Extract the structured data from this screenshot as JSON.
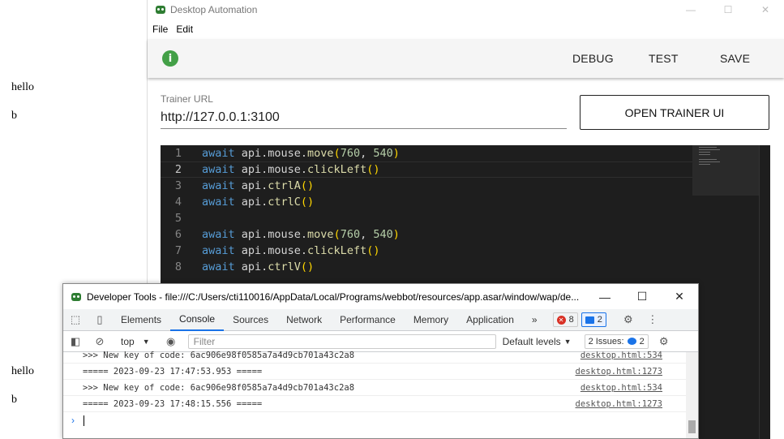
{
  "background": {
    "text_top": "hello",
    "text_top2": "b",
    "text_bottom": "hello",
    "text_bottom2": "b"
  },
  "app": {
    "title": "Desktop Automation",
    "menu": [
      "File",
      "Edit"
    ],
    "toolbar": {
      "debug": "DEBUG",
      "test": "TEST",
      "save": "SAVE",
      "info_icon": "info-icon"
    },
    "trainer_url_label": "Trainer URL",
    "trainer_url_value": "http://127.0.0.1:3100",
    "open_trainer_label": "OPEN TRAINER UI",
    "editor": {
      "lines": [
        {
          "num": "1",
          "parts": [
            [
              "kw",
              "await"
            ],
            [
              "t",
              " api.mouse."
            ],
            [
              "fn",
              "move"
            ],
            [
              "par",
              "("
            ],
            [
              "num",
              "760"
            ],
            [
              "t",
              ", "
            ],
            [
              "num",
              "540"
            ],
            [
              "par",
              ")"
            ]
          ]
        },
        {
          "num": "2",
          "parts": [
            [
              "kw",
              "await"
            ],
            [
              "t",
              " api.mouse."
            ],
            [
              "fn",
              "clickLeft"
            ],
            [
              "par",
              "()"
            ]
          ]
        },
        {
          "num": "3",
          "parts": [
            [
              "kw",
              "await"
            ],
            [
              "t",
              " api."
            ],
            [
              "fn",
              "ctrlA"
            ],
            [
              "par",
              "()"
            ]
          ]
        },
        {
          "num": "4",
          "parts": [
            [
              "kw",
              "await"
            ],
            [
              "t",
              " api."
            ],
            [
              "fn",
              "ctrlC"
            ],
            [
              "par",
              "()"
            ]
          ]
        },
        {
          "num": "5",
          "parts": []
        },
        {
          "num": "6",
          "parts": [
            [
              "kw",
              "await"
            ],
            [
              "t",
              " api.mouse."
            ],
            [
              "fn",
              "move"
            ],
            [
              "par",
              "("
            ],
            [
              "num",
              "760"
            ],
            [
              "t",
              ", "
            ],
            [
              "num",
              "540"
            ],
            [
              "par",
              ")"
            ]
          ]
        },
        {
          "num": "7",
          "parts": [
            [
              "kw",
              "await"
            ],
            [
              "t",
              " api.mouse."
            ],
            [
              "fn",
              "clickLeft"
            ],
            [
              "par",
              "()"
            ]
          ]
        },
        {
          "num": "8",
          "parts": [
            [
              "kw",
              "await"
            ],
            [
              "t",
              " api."
            ],
            [
              "fn",
              "ctrlV"
            ],
            [
              "par",
              "()"
            ]
          ]
        }
      ],
      "active_line": 2
    }
  },
  "devtools": {
    "title": "Developer Tools - file:///C:/Users/cti110016/AppData/Local/Programs/webbot/resources/app.asar/window/wap/de...",
    "tabs": [
      "Elements",
      "Console",
      "Sources",
      "Network",
      "Performance",
      "Memory",
      "Application"
    ],
    "active_tab": "Console",
    "more_tabs": "»",
    "errors_count": "8",
    "messages_count": "2",
    "context": "top",
    "filter_placeholder": "Filter",
    "levels": "Default levels",
    "issues_label": "2 Issues:",
    "issues_count": "2",
    "logs": [
      {
        "msg": ">>> New key of code: 6ac906e98f0585a7a4d9cb701a43c2a8",
        "src": "desktop.html:534"
      },
      {
        "msg": "===== 2023-09-23 17:47:53.953 =====",
        "src": "desktop.html:1273"
      },
      {
        "msg": ">>> New key of code: 6ac906e98f0585a7a4d9cb701a43c2a8",
        "src": "desktop.html:534"
      },
      {
        "msg": "===== 2023-09-23 17:48:15.556 =====",
        "src": "desktop.html:1273"
      }
    ]
  }
}
